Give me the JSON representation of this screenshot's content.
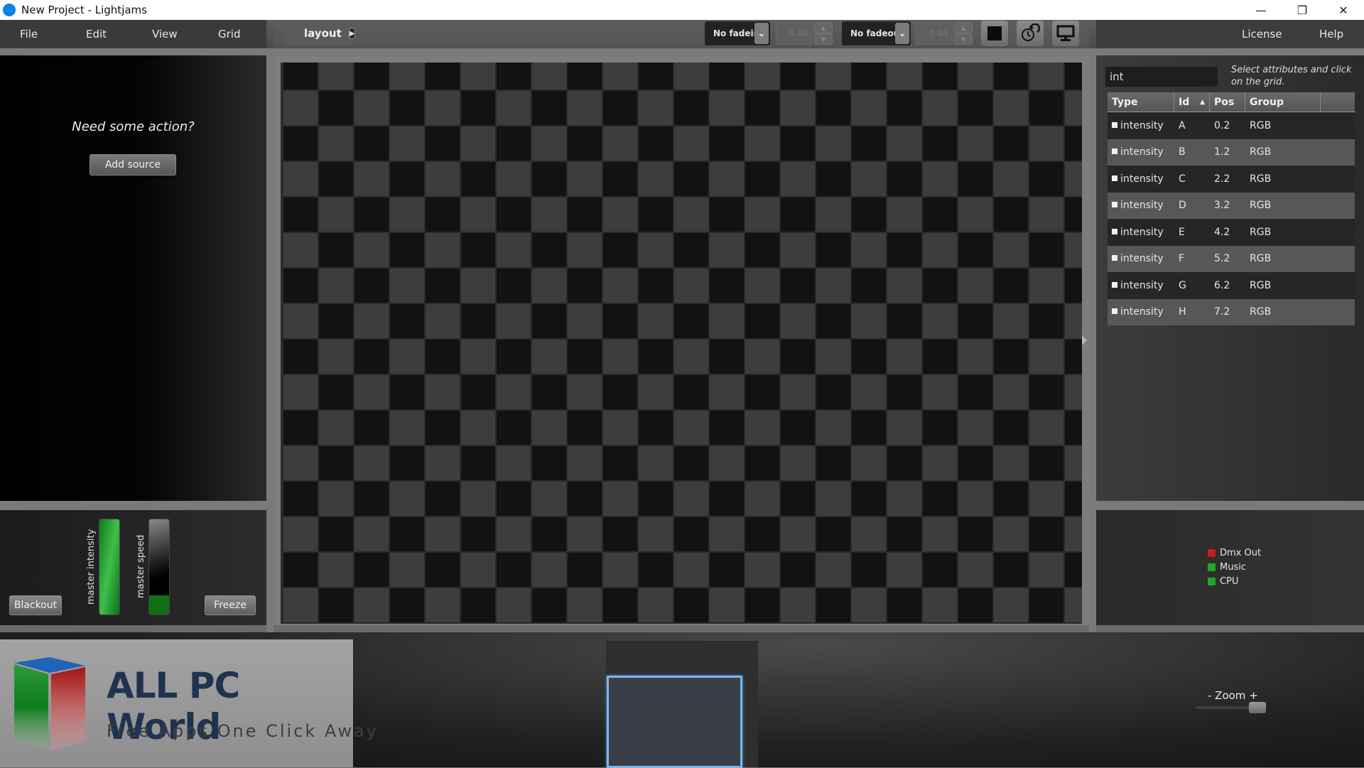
{
  "window": {
    "title": "New Project - Lightjams",
    "controls": [
      "minimize",
      "restore",
      "close"
    ]
  },
  "menu": {
    "items": [
      "File",
      "Edit",
      "View",
      "Grid"
    ],
    "right_items": [
      "License",
      "Help"
    ]
  },
  "toolbar": {
    "layout_tab": "layout",
    "fadein": {
      "selected": "No fadein",
      "value": "0.40"
    },
    "fadeout": {
      "selected": "No fadeout",
      "value": "0.40"
    },
    "icons": [
      "stop-square-icon",
      "timer-reset-icon",
      "monitor-icon"
    ]
  },
  "left_panel": {
    "prompt": "Need some action?",
    "add_source_label": "Add source"
  },
  "master": {
    "blackout_label": "Blackout",
    "freeze_label": "Freeze",
    "intensity_label": "master intensity",
    "speed_label": "master speed",
    "intensity_level": 1.0,
    "speed_level": 0.2
  },
  "grid": {
    "columns": 23,
    "rows": 16,
    "colors": {
      "dark": "#121212",
      "light": "#3d3d3d"
    }
  },
  "attributes": {
    "filter_value": "int",
    "hint": "Select attributes and click on the grid.",
    "columns": [
      "Type",
      "Id",
      "Pos",
      "Group"
    ],
    "sort_column": "Id",
    "rows": [
      {
        "type": "intensity",
        "id": "A",
        "pos": "0.2",
        "group": "RGB"
      },
      {
        "type": "intensity",
        "id": "B",
        "pos": "1.2",
        "group": "RGB"
      },
      {
        "type": "intensity",
        "id": "C",
        "pos": "2.2",
        "group": "RGB"
      },
      {
        "type": "intensity",
        "id": "D",
        "pos": "3.2",
        "group": "RGB"
      },
      {
        "type": "intensity",
        "id": "E",
        "pos": "4.2",
        "group": "RGB"
      },
      {
        "type": "intensity",
        "id": "F",
        "pos": "5.2",
        "group": "RGB"
      },
      {
        "type": "intensity",
        "id": "G",
        "pos": "6.2",
        "group": "RGB"
      },
      {
        "type": "intensity",
        "id": "H",
        "pos": "7.2",
        "group": "RGB"
      }
    ]
  },
  "status": [
    {
      "label": "Dmx Out",
      "color": "#c81e1e"
    },
    {
      "label": "Music",
      "color": "#1fa82a"
    },
    {
      "label": "CPU",
      "color": "#1fa82a"
    }
  ],
  "zoom": {
    "label": "- Zoom +",
    "level": 0.85
  },
  "watermark": {
    "title": "ALL PC World",
    "subtitle": "Free Apps One Click Away"
  }
}
